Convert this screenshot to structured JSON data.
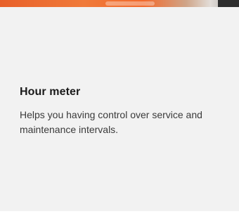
{
  "feature": {
    "title": "Hour meter",
    "description": "Helps you having control over service and maintenance intervals."
  }
}
